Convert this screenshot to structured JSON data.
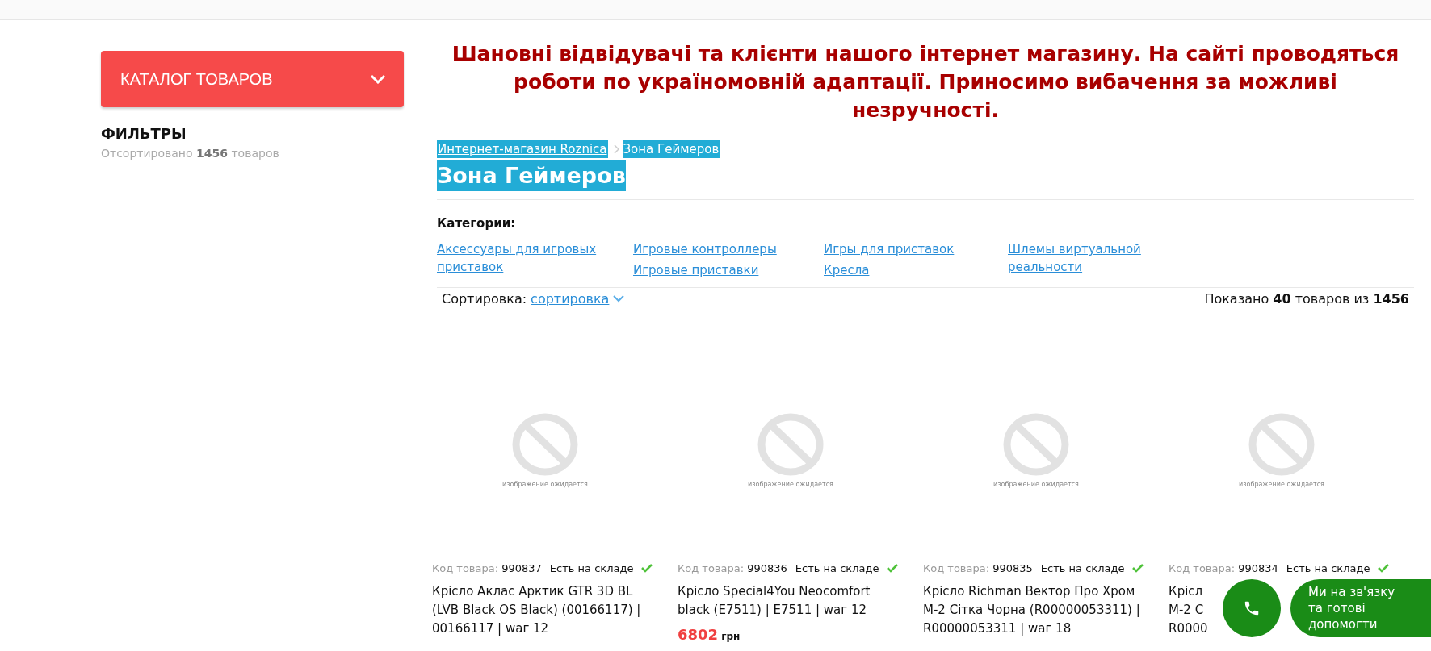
{
  "sidebar": {
    "catalog_button": "КАТАЛОГ ТОВАРОВ",
    "filters_title": "ФИЛЬТРЫ",
    "sorted_prefix": "Отсортировано",
    "sorted_count": "1456",
    "sorted_suffix": "товаров"
  },
  "notice": "Шановні відвідувачі та клієнти нашого інтернет магазину. На сайті проводяться роботи по україномовній адаптації. Приносимо вибачення за можливі незручності.",
  "breadcrumbs": [
    {
      "label": "Интернет-магазин Roznica",
      "kind": "link"
    },
    {
      "label": "Зона Геймеров",
      "kind": "current"
    }
  ],
  "page_title": "Зона Геймеров",
  "categories": {
    "label": "Категории:",
    "columns": [
      [
        "Аксессуары для игровых приставок"
      ],
      [
        "Игровые контроллеры",
        "Игровые приставки"
      ],
      [
        "Игры для приставок",
        "Кресла"
      ],
      [
        "Шлемы виртуальной реальности"
      ]
    ]
  },
  "sort": {
    "label": "Сортировка:",
    "value": "сортировка",
    "shown_prefix": "Показано",
    "shown": "40",
    "shown_middle": "товаров из",
    "total": "1456"
  },
  "products": [
    {
      "image_caption": "изображение ожидается",
      "code_label": "Код товара:",
      "code": "990837",
      "stock": "Есть на складе",
      "in_stock": true,
      "title_lines": [
        "Крісло Аклас Арктик GTR 3D BL",
        "(LVB Black OS Black) (00166117) |",
        "00166117 | waг 12"
      ]
    },
    {
      "image_caption": "изображение ожидается",
      "code_label": "Код товара:",
      "code": "990836",
      "stock": "Есть на складе",
      "in_stock": true,
      "title_lines": [
        "Крісло Special4You Neocomfort",
        "black (E7511) | E7511 | waг 12"
      ],
      "price": "6802",
      "currency": "грн"
    },
    {
      "image_caption": "изображение ожидается",
      "code_label": "Код товара:",
      "code": "990835",
      "stock": "Есть на складе",
      "in_stock": true,
      "title_lines": [
        "Крісло Richman Вектор Про Хром",
        "M-2 Сітка Чорна (R00000053311) |",
        "R00000053311 | waг 18"
      ]
    },
    {
      "image_caption": "изображение ожидается",
      "code_label": "Код товара:",
      "code": "990834",
      "stock": "Есть на складе",
      "in_stock": true,
      "title_lines": [
        "Крісл",
        "M-2 C",
        "R0000"
      ]
    }
  ],
  "contact_widget": {
    "line_1": "Ми на зв'язку",
    "line_2": "та готові допомогти"
  }
}
